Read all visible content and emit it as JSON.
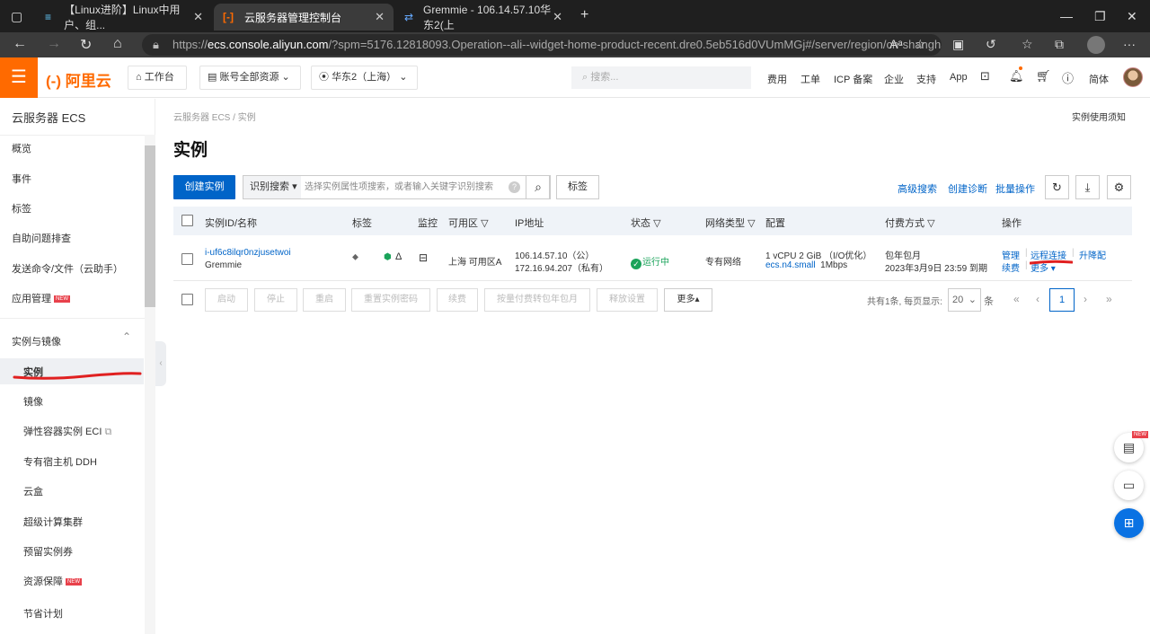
{
  "browser": {
    "tabs": [
      {
        "title": "【Linux进阶】Linux中用户、组...",
        "close": "✕"
      },
      {
        "title": "云服务器管理控制台",
        "close": "✕"
      },
      {
        "title": "Gremmie - 106.14.57.10华东2(上",
        "close": "✕"
      }
    ],
    "new_tab": "+",
    "url_scheme": "https://",
    "url_host": "ecs.console.aliyun.com",
    "url_rest": "/?spm=5176.12818093.Operation--ali--widget-home-product-recent.dre0.5eb516d0VUmMGj#/server/region/cn-shanghai"
  },
  "header": {
    "logo": "阿里云",
    "workbench": "工作台",
    "account_resources": "账号全部资源",
    "region": "华东2（上海）",
    "search_placeholder": "搜索...",
    "links": [
      "费用",
      "工单",
      "ICP 备案",
      "企业",
      "支持",
      "App"
    ],
    "lang": "简体"
  },
  "sidebar": {
    "title": "云服务器 ECS",
    "items": [
      "概览",
      "事件",
      "标签",
      "自助问题排查",
      "发送命令/文件（云助手）",
      "应用管理"
    ],
    "group": "实例与镜像",
    "sub_items": [
      "实例",
      "镜像",
      "弹性容器实例 ECI",
      "专有宿主机 DDH",
      "云盒",
      "超级计算集群",
      "预留实例券",
      "资源保障",
      "节省计划"
    ],
    "new_badge": "NEW"
  },
  "main": {
    "breadcrumb_root": "云服务器 ECS",
    "breadcrumb_sep": "/",
    "breadcrumb_current": "实例",
    "help_link": "实例使用须知",
    "title": "实例",
    "create_button": "创建实例",
    "search_type": "识别搜索",
    "search_placeholder": "选择实例属性项搜索，或者输入关键字识别搜索",
    "tag_button": "标签",
    "advanced_search": "高级搜索",
    "create_diagnosis": "创建诊断",
    "batch_ops": "批量操作"
  },
  "table": {
    "headers": [
      "实例ID/名称",
      "标签",
      "监控",
      "可用区",
      "IP地址",
      "状态",
      "网络类型",
      "配置",
      "付费方式",
      "操作"
    ],
    "row": {
      "id": "i-uf6c8ilqr0nzjusetwoi",
      "name": "Gremmie",
      "zone": "上海 可用区A",
      "public_ip": "106.14.57.10（公）",
      "private_ip": "172.16.94.207（私有）",
      "status": "运行中",
      "network": "专有网络",
      "config_line1": "1 vCPU 2 GiB （I/O优化）",
      "config_type": "ecs.n4.small",
      "bandwidth": "1Mbps",
      "billing": "包年包月",
      "expiry": "2023年3月9日 23:59 到期",
      "ops": [
        "管理",
        "远程连接",
        "升降配",
        "续费",
        "更多"
      ]
    }
  },
  "footer": {
    "buttons": [
      "启动",
      "停止",
      "重启",
      "重置实例密码",
      "续费",
      "按量付费转包年包月",
      "释放设置"
    ],
    "more": "更多▴",
    "total_text": "共有1条, 每页显示:",
    "page_size": "20",
    "unit": "条",
    "page": "1"
  },
  "colors": {
    "brand": "#ff6a00",
    "primary": "#0064c8",
    "running": "#1aa35a"
  }
}
